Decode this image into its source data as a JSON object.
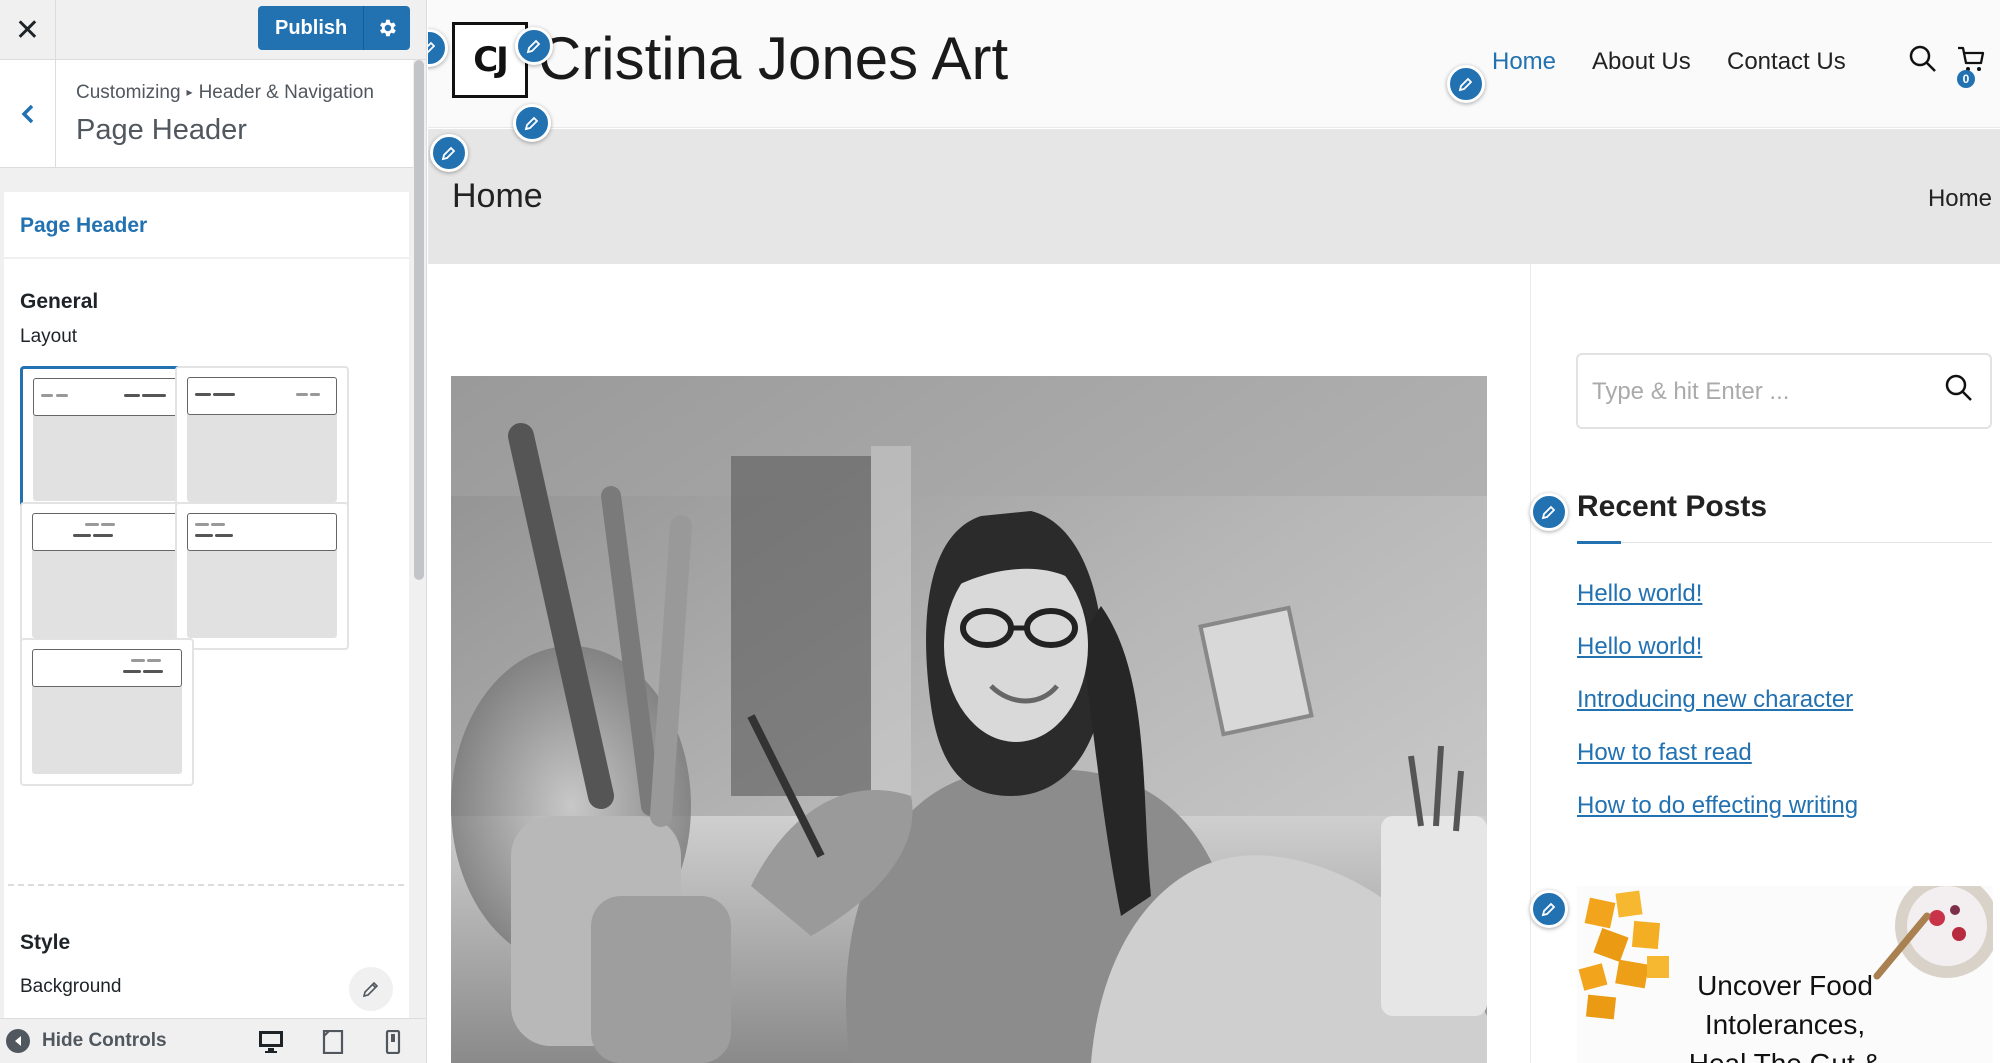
{
  "customizer": {
    "close_symbol": "✕",
    "publish_label": "Publish",
    "breadcrumb": [
      "Customizing",
      "Header & Navigation"
    ],
    "breadcrumb_separator": "▸",
    "section_title": "Page Header",
    "panel_tab": "Page Header",
    "general_label": "General",
    "layout_label": "Layout",
    "layout_options_count": 5,
    "selected_layout_index": 0,
    "style_label": "Style",
    "background_label": "Background",
    "hide_controls_label": "Hide Controls",
    "devices": [
      "desktop-icon",
      "tablet-icon",
      "mobile-icon"
    ],
    "accent_color": "#2271b1"
  },
  "site": {
    "logo_text": "CJ",
    "title": "Cristina Jones Art",
    "nav": [
      {
        "label": "Home",
        "active": true
      },
      {
        "label": "About Us",
        "active": false
      },
      {
        "label": "Contact Us",
        "active": false
      }
    ],
    "cart_count": "0",
    "page_title": "Home",
    "breadcrumb": "Home",
    "search_placeholder": "Type & hit Enter ...",
    "recent_posts_title": "Recent Posts",
    "recent_posts": [
      "Hello world!",
      "Hello world!",
      "Introducing new character",
      "How to fast read",
      "How to do effecting writing"
    ],
    "ad_text_lines": [
      "Uncover Food",
      "Intolerances,",
      "Heal The Gut &"
    ]
  }
}
